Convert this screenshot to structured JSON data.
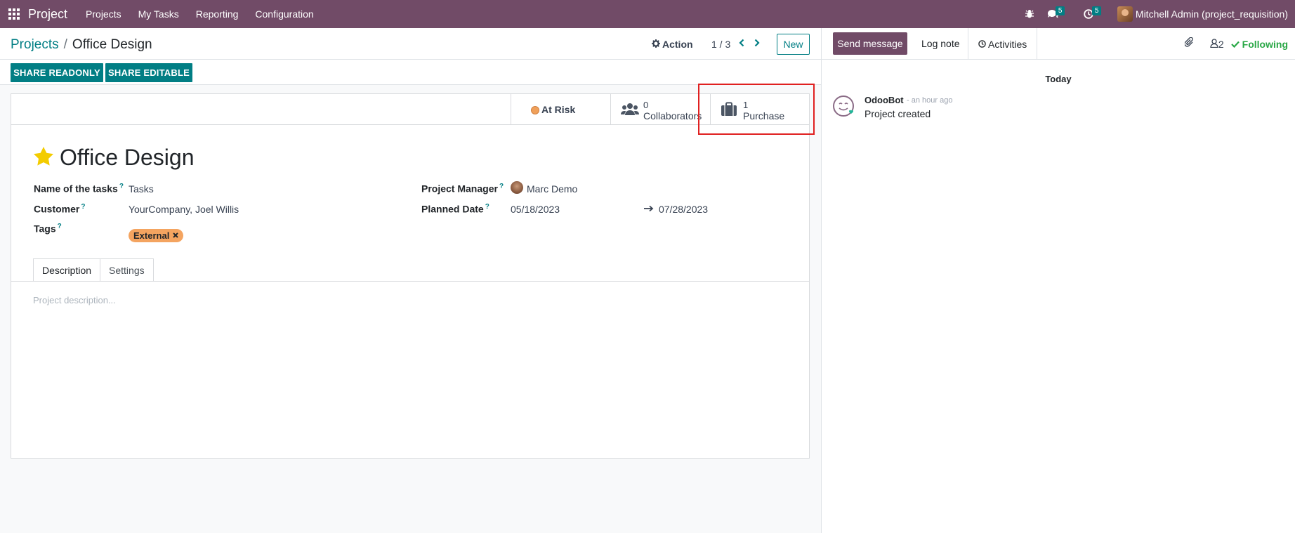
{
  "navbar": {
    "app_name": "Project",
    "menu": [
      "Projects",
      "My Tasks",
      "Reporting",
      "Configuration"
    ],
    "messages_count": "5",
    "activities_count": "5",
    "user_name": "Mitchell Admin (project_requisition)",
    "bg_color": "#714b67"
  },
  "control_panel": {
    "breadcrumb_parent": "Projects",
    "breadcrumb_sep": "/",
    "breadcrumb_current": "Office Design",
    "action_label": "Action",
    "pager": "1 / 3",
    "new_label": "New"
  },
  "share": {
    "readonly_label": "SHARE READONLY",
    "editable_label": "SHARE EDITABLE"
  },
  "smart_buttons": {
    "status_label": "At Risk",
    "collaborators_count": "0",
    "collaborators_label": "Collaborators",
    "purchase_count": "1",
    "purchase_label": "Purchase"
  },
  "form": {
    "title": "Office Design",
    "fields": {
      "tasks_name_label": "Name of the tasks",
      "tasks_name_value": "Tasks",
      "customer_label": "Customer",
      "customer_value": "YourCompany, Joel Willis",
      "tags_label": "Tags",
      "tag_value": "External",
      "manager_label": "Project Manager",
      "manager_value": "Marc Demo",
      "planned_label": "Planned Date",
      "planned_start": "05/18/2023",
      "planned_end": "07/28/2023",
      "help_mark": "?"
    },
    "tabs": [
      "Description",
      "Settings"
    ],
    "description_placeholder": "Project description..."
  },
  "chatter": {
    "send_message": "Send message",
    "log_note": "Log note",
    "activities": "Activities",
    "followers_count": "2",
    "following": "Following",
    "date_separator": "Today",
    "message": {
      "author": "OdooBot",
      "time": "- an hour ago",
      "body": "Project created"
    }
  },
  "colors": {
    "brand": "#714b67",
    "accent": "#017e84",
    "tag": "#f4a460",
    "at_risk": "#f0a05a",
    "following": "#28a745",
    "highlight": "#e02020"
  }
}
